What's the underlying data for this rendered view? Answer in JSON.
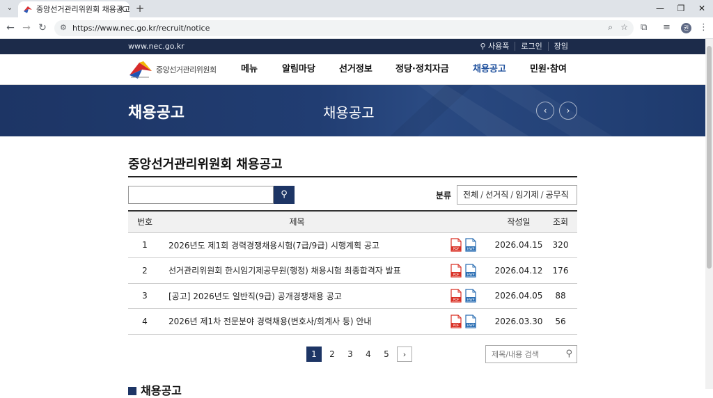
{
  "browser": {
    "tab_title": "중앙선거관리위원회 채용공고",
    "tab_close": "✕",
    "new_tab": "+",
    "url": "https://www.nec.go.kr/recruit/notice",
    "avatar_initial": "권"
  },
  "site": {
    "domain": "www.nec.go.kr",
    "top_links": [
      "사용폭",
      "로그인",
      "장임"
    ],
    "logo_text": "중앙선거관리위원회",
    "menu": [
      "메뉴",
      "알림마당",
      "선거정보",
      "정당·정치자금",
      "채용공고",
      "민원·참여"
    ],
    "active_menu_index": 4,
    "accent_color": "#1d3565"
  },
  "banner": {
    "title": "채용공고",
    "subtitle": "채용공고"
  },
  "main": {
    "heading": "중앙선거관리위원회 채용공고",
    "search_placeholder": "",
    "category_label": "분류",
    "categories": [
      "전체",
      "선거직",
      "임기제",
      "공무직"
    ],
    "table": {
      "headers": {
        "no": "번호",
        "title": "제목",
        "date": "작성일",
        "views": "조회"
      },
      "rows": [
        {
          "no": "1",
          "title": "2026년도 제1회 경력경쟁채용시험(7급/9급) 시행계획 공고",
          "date": "2026.04.15",
          "views": "320"
        },
        {
          "no": "2",
          "title": "선거관리위원회 한시임기제공무원(행정) 채용시험 최종합격자 발표",
          "date": "2026.04.12",
          "views": "176"
        },
        {
          "no": "3",
          "title": "[공고] 2026년도 일반직(9급) 공개경쟁채용 공고",
          "date": "2026.04.05",
          "views": "88"
        },
        {
          "no": "4",
          "title": "2026년 제1차 전문분야 경력채용(변호사/회계사 등) 안내",
          "date": "2026.03.30",
          "views": "56"
        }
      ],
      "file_labels": {
        "pdf": "PDF",
        "hwp": "HWP"
      }
    },
    "pagination": {
      "pages": [
        "1",
        "2",
        "3",
        "4",
        "5"
      ],
      "current": "1",
      "next": "›"
    },
    "board_search_placeholder": "제목/내용 검색",
    "next_section_title": "채용공고"
  }
}
